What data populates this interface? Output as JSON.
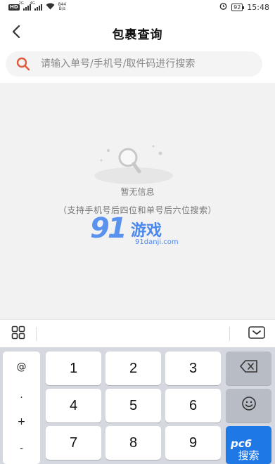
{
  "status_bar": {
    "hd_badge": "HD",
    "network_1": "2G",
    "network_2": "4G",
    "speed_value": "844",
    "speed_unit": "B/s",
    "battery": "92",
    "time": "15:48"
  },
  "header": {
    "title": "包裹查询",
    "back_icon": "chevron-left-icon"
  },
  "search": {
    "placeholder": "请输入单号/手机号/取件码进行搜索",
    "value": "",
    "icon": "search-icon",
    "accent_color": "#e05a3c"
  },
  "empty_state": {
    "title": "暂无信息",
    "hint": "（支持手机号后四位和单号后六位搜索）",
    "illustration": "magnifier-empty-icon"
  },
  "watermarks": {
    "brand_91_number": "91",
    "brand_91_text": "游戏",
    "brand_91_url": "91danji.com",
    "brand_pc6": "pc6"
  },
  "keyboard_toolbar": {
    "left_icon": "grid-icon",
    "right_icon": "keyboard-hide-icon"
  },
  "keyboard": {
    "symbols": [
      "@",
      ".",
      "+",
      "-"
    ],
    "keys": {
      "k1": "1",
      "k2": "2",
      "k3": "3",
      "k4": "4",
      "k5": "5",
      "k6": "6",
      "k7": "7",
      "k8": "8",
      "k9": "9"
    },
    "backspace_icon": "backspace-icon",
    "emoji_icon": "emoji-icon",
    "search_label": "搜索",
    "search_key_color": "#1e78e6"
  }
}
